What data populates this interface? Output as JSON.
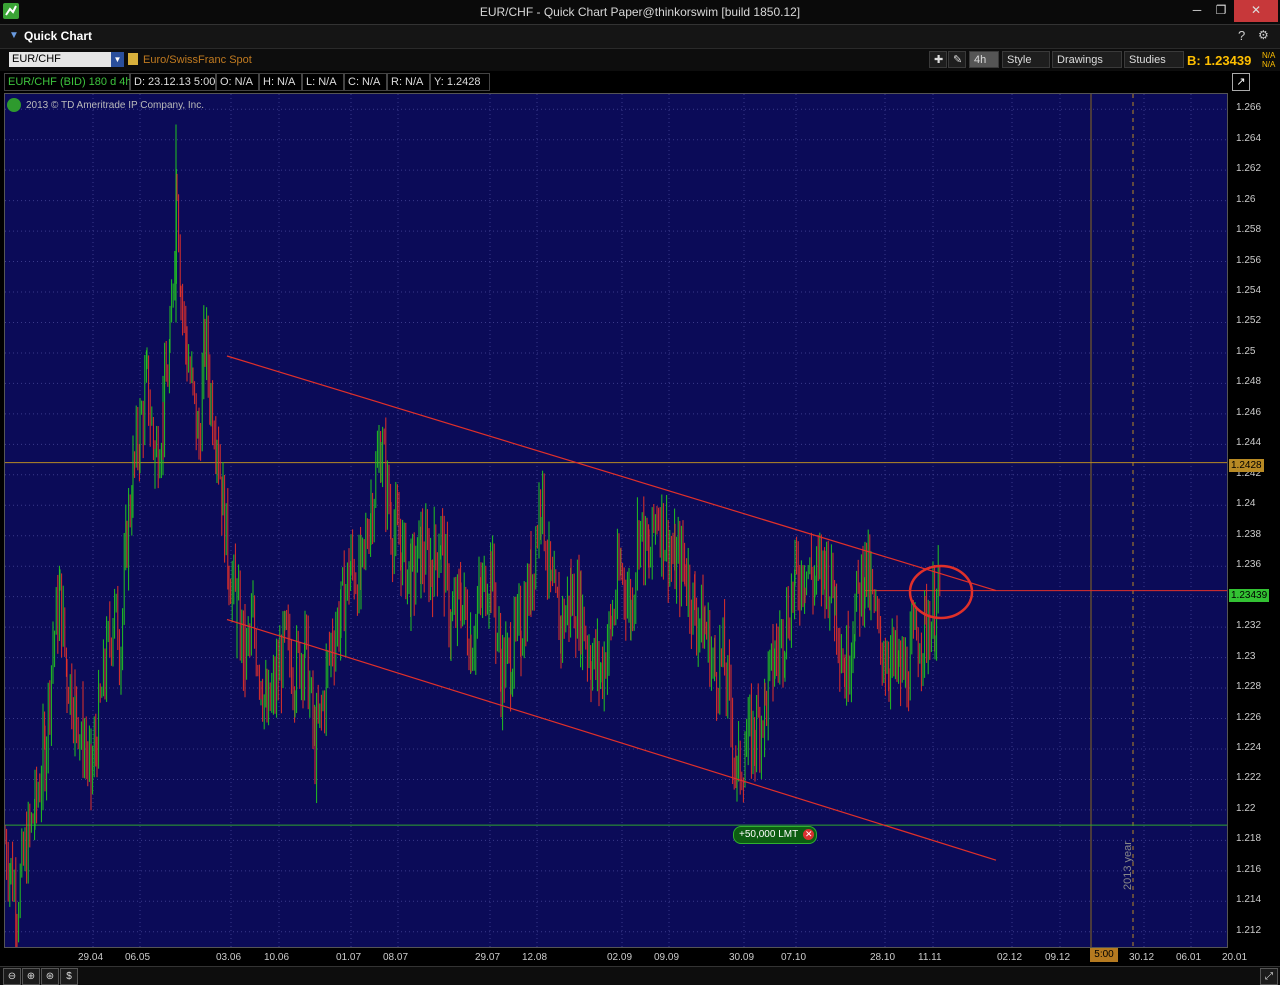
{
  "window": {
    "title": "EUR/CHF - Quick Chart Paper@thinkorswim [build 1850.12]",
    "minimize": "─",
    "maximize": "❐",
    "close": "✕"
  },
  "panel": {
    "title": "Quick Chart"
  },
  "toolbar": {
    "symbol": "EUR/CHF",
    "description": "Euro/SwissFranc Spot",
    "aggregation": "4h",
    "style": "Style",
    "drawings": "Drawings",
    "studies": "Studies",
    "bid": "B: 1.23439",
    "na_top": "N/A",
    "na_bottom": "N/A"
  },
  "info": {
    "series": "EUR/CHF (BID) 180 d 4h",
    "date": "D: 23.12.13 5:00",
    "open": "O: N/A",
    "high": "H: N/A",
    "low": "L: N/A",
    "close": "C: N/A",
    "range": "R: N/A",
    "y": "Y: 1.2428"
  },
  "copyright": "2013 © TD Ameritrade IP Company, Inc.",
  "order": {
    "label": "+50,000 LMT"
  },
  "year_marker": "2013 year",
  "price_labels": {
    "crosshair": "1.2428",
    "last": "1.23439"
  },
  "time_label": "5:00",
  "chart_data": {
    "type": "candlestick",
    "y_ticks": [
      "1.266",
      "1.264",
      "1.262",
      "1.26",
      "1.258",
      "1.256",
      "1.254",
      "1.252",
      "1.25",
      "1.248",
      "1.246",
      "1.244",
      "1.242",
      "1.24",
      "1.238",
      "1.236",
      "1.234",
      "1.232",
      "1.23",
      "1.228",
      "1.226",
      "1.224",
      "1.222",
      "1.22",
      "1.218",
      "1.216",
      "1.214",
      "1.212"
    ],
    "x_ticks": [
      "29.04",
      "06.05",
      "03.06",
      "10.06",
      "01.07",
      "08.07",
      "29.07",
      "12.08",
      "02.09",
      "09.09",
      "30.09",
      "07.10",
      "28.10",
      "11.11",
      "02.12",
      "09.12",
      "30.12",
      "06.01",
      "20.01"
    ],
    "ylim": [
      1.211,
      1.267
    ],
    "price_points": [
      [
        0,
        1.218
      ],
      [
        6,
        1.216
      ],
      [
        12,
        1.214
      ],
      [
        20,
        1.217
      ],
      [
        30,
        1.22
      ],
      [
        40,
        1.224
      ],
      [
        48,
        1.231
      ],
      [
        55,
        1.234
      ],
      [
        62,
        1.229
      ],
      [
        70,
        1.227
      ],
      [
        78,
        1.225
      ],
      [
        86,
        1.222
      ],
      [
        92,
        1.225
      ],
      [
        100,
        1.229
      ],
      [
        108,
        1.233
      ],
      [
        116,
        1.231
      ],
      [
        122,
        1.238
      ],
      [
        128,
        1.242
      ],
      [
        135,
        1.245
      ],
      [
        142,
        1.248
      ],
      [
        150,
        1.243
      ],
      [
        158,
        1.246
      ],
      [
        165,
        1.25
      ],
      [
        172,
        1.262
      ],
      [
        176,
        1.254
      ],
      [
        182,
        1.25
      ],
      [
        188,
        1.247
      ],
      [
        194,
        1.244
      ],
      [
        200,
        1.251
      ],
      [
        206,
        1.247
      ],
      [
        212,
        1.245
      ],
      [
        218,
        1.24
      ],
      [
        224,
        1.236
      ],
      [
        232,
        1.233
      ],
      [
        240,
        1.23
      ],
      [
        248,
        1.232
      ],
      [
        256,
        1.229
      ],
      [
        262,
        1.226
      ],
      [
        270,
        1.228
      ],
      [
        280,
        1.231
      ],
      [
        290,
        1.229
      ],
      [
        300,
        1.231
      ],
      [
        310,
        1.224
      ],
      [
        318,
        1.227
      ],
      [
        326,
        1.231
      ],
      [
        336,
        1.233
      ],
      [
        346,
        1.236
      ],
      [
        356,
        1.235
      ],
      [
        366,
        1.24
      ],
      [
        376,
        1.244
      ],
      [
        386,
        1.239
      ],
      [
        396,
        1.237
      ],
      [
        406,
        1.235
      ],
      [
        416,
        1.237
      ],
      [
        426,
        1.236
      ],
      [
        436,
        1.238
      ],
      [
        446,
        1.232
      ],
      [
        456,
        1.234
      ],
      [
        466,
        1.231
      ],
      [
        476,
        1.234
      ],
      [
        486,
        1.236
      ],
      [
        496,
        1.229
      ],
      [
        506,
        1.23
      ],
      [
        516,
        1.232
      ],
      [
        526,
        1.235
      ],
      [
        536,
        1.241
      ],
      [
        546,
        1.234
      ],
      [
        556,
        1.232
      ],
      [
        566,
        1.234
      ],
      [
        576,
        1.233
      ],
      [
        586,
        1.23
      ],
      [
        596,
        1.229
      ],
      [
        606,
        1.232
      ],
      [
        616,
        1.236
      ],
      [
        626,
        1.233
      ],
      [
        634,
        1.239
      ],
      [
        644,
        1.236
      ],
      [
        652,
        1.24
      ],
      [
        660,
        1.238
      ],
      [
        670,
        1.236
      ],
      [
        680,
        1.236
      ],
      [
        690,
        1.233
      ],
      [
        700,
        1.232
      ],
      [
        710,
        1.229
      ],
      [
        718,
        1.23
      ],
      [
        726,
        1.226
      ],
      [
        732,
        1.222
      ],
      [
        740,
        1.224
      ],
      [
        750,
        1.225
      ],
      [
        760,
        1.227
      ],
      [
        770,
        1.23
      ],
      [
        780,
        1.232
      ],
      [
        790,
        1.235
      ],
      [
        800,
        1.236
      ],
      [
        810,
        1.235
      ],
      [
        820,
        1.236
      ],
      [
        830,
        1.234
      ],
      [
        840,
        1.229
      ],
      [
        850,
        1.233
      ],
      [
        860,
        1.236
      ],
      [
        866,
        1.234
      ],
      [
        874,
        1.231
      ],
      [
        884,
        1.23
      ],
      [
        894,
        1.229
      ],
      [
        902,
        1.229
      ],
      [
        910,
        1.231
      ],
      [
        920,
        1.232
      ],
      [
        930,
        1.233
      ],
      [
        936,
        1.2344
      ]
    ],
    "trendlines": [
      {
        "from": [
          "03.06",
          1.25
        ],
        "to": [
          "02.12",
          1.2348
        ]
      },
      {
        "from": [
          "03.06",
          1.232
        ],
        "to": [
          "02.12",
          1.2165
        ]
      }
    ],
    "horizontal_levels": [
      1.2428,
      1.2344,
      1.219
    ]
  }
}
